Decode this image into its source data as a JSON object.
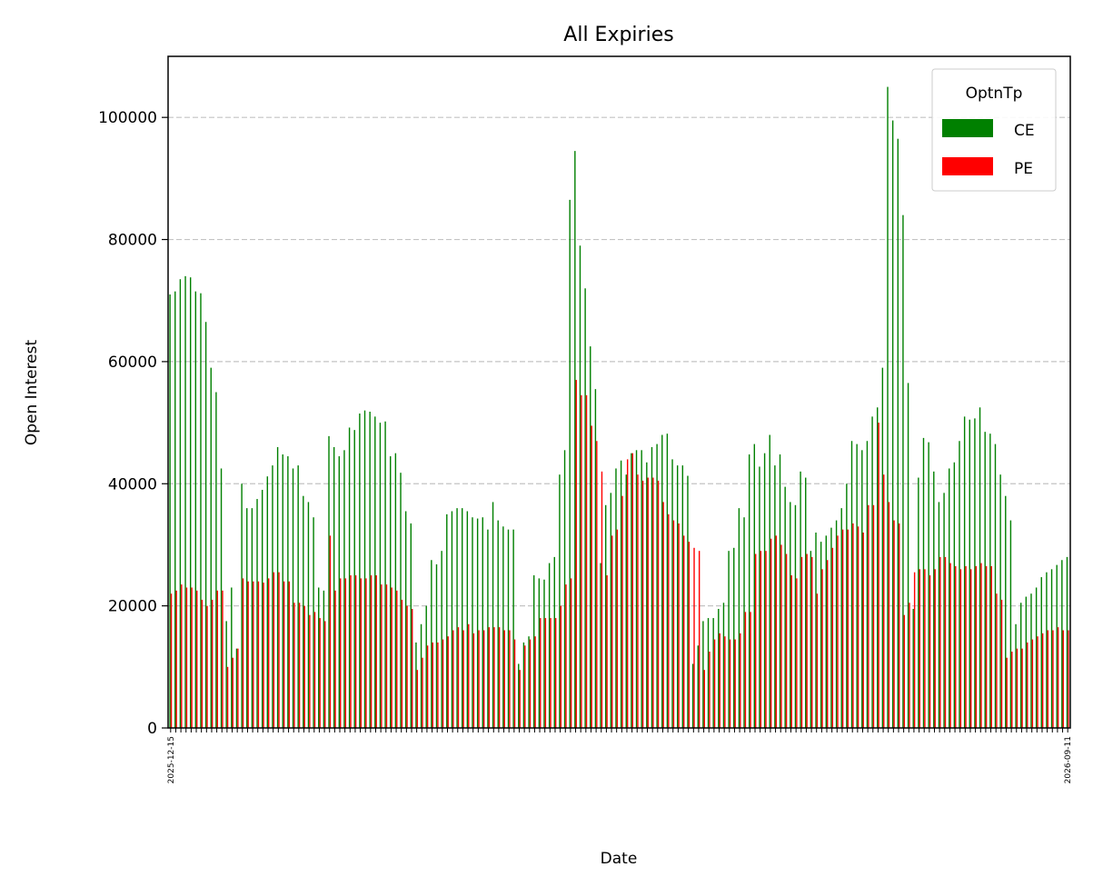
{
  "chart_data": {
    "type": "bar",
    "title": "All Expiries",
    "xlabel": "Date",
    "ylabel": "Open Interest",
    "ylim": [
      0,
      110000
    ],
    "yticks": [
      0,
      20000,
      40000,
      60000,
      80000,
      100000
    ],
    "grid": "y-dashed",
    "legend": {
      "title": "OptnTp",
      "placement": "top-right"
    },
    "colors": {
      "CE": "#008000",
      "PE": "#ff0000"
    },
    "first_category": "2025-12-15",
    "last_category": "2026-09-11",
    "series": [
      {
        "name": "CE",
        "values": [
          71000,
          71500,
          73500,
          74000,
          73800,
          71500,
          71200,
          66500,
          59000,
          55000,
          42500,
          17500,
          23000,
          13000,
          40000,
          36000,
          36000,
          37500,
          39000,
          41200,
          43000,
          46000,
          44800,
          44500,
          42500,
          43000,
          38000,
          37000,
          34500,
          23000,
          22500,
          47800,
          46000,
          44500,
          45500,
          49200,
          48800,
          51500,
          52000,
          51800,
          51000,
          50000,
          50200,
          44500,
          45000,
          41800,
          35500,
          33500,
          14000,
          17000,
          20000,
          27500,
          26800,
          29000,
          35000,
          35500,
          36000,
          36000,
          35500,
          34500,
          34300,
          34500,
          32500,
          37000,
          34000,
          33000,
          32500,
          32500,
          10500,
          14000,
          15000,
          25000,
          24500,
          24300,
          27000,
          28000,
          41500,
          45500,
          86500,
          94500,
          79000,
          72000,
          62500,
          55500,
          27000,
          36500,
          38500,
          42500,
          43800,
          41500,
          45000,
          45500,
          45500,
          43500,
          46000,
          46500,
          48000,
          48200,
          44000,
          43000,
          43000,
          41300,
          10500,
          13500,
          17500,
          18000,
          18000,
          19500,
          20500,
          29000,
          29500,
          36000,
          34500,
          44800,
          46500,
          42800,
          45000,
          48000,
          43000,
          44800,
          39500,
          37000,
          36500,
          42000,
          41000,
          29000,
          32000,
          30500,
          31500,
          32800,
          34000,
          36000,
          40000,
          47000,
          46500,
          45500,
          47000,
          51000,
          52500,
          59000,
          105000,
          99500,
          96500,
          84000,
          56500,
          19500,
          41000,
          47500,
          46800,
          42000,
          37000,
          38500,
          42500,
          43500,
          47000,
          51000,
          50500,
          50700,
          52500,
          48500,
          48200,
          46500,
          41500,
          38000,
          34000,
          17000,
          20500,
          21500,
          22000,
          23000,
          24700,
          25500,
          26000,
          26700,
          27500,
          28000
        ]
      },
      {
        "name": "PE",
        "values": [
          22000,
          22500,
          23500,
          23000,
          23000,
          22500,
          21000,
          20000,
          21000,
          22500,
          22500,
          10000,
          11500,
          13000,
          24500,
          24000,
          24000,
          24000,
          23800,
          24500,
          25500,
          25500,
          24000,
          24000,
          20500,
          20500,
          20000,
          18500,
          19000,
          18000,
          17500,
          31500,
          22500,
          24500,
          24500,
          25000,
          25000,
          24500,
          24500,
          25000,
          25000,
          23500,
          23500,
          23000,
          22500,
          21000,
          20000,
          19500,
          9500,
          11500,
          13500,
          14000,
          14000,
          14500,
          15000,
          16000,
          16500,
          16000,
          17000,
          15500,
          16000,
          16000,
          16500,
          16500,
          16500,
          16000,
          16000,
          14500,
          9500,
          13500,
          14500,
          15000,
          18000,
          18000,
          18000,
          18000,
          20000,
          23500,
          24500,
          57000,
          54500,
          54500,
          49500,
          47000,
          42000,
          25000,
          31500,
          32500,
          38000,
          44000,
          45000,
          41500,
          40500,
          41000,
          41000,
          40500,
          37000,
          35000,
          34000,
          33500,
          31500,
          30500,
          29500,
          29000,
          9500,
          12500,
          14500,
          15500,
          15000,
          14500,
          14500,
          15500,
          19000,
          19000,
          28500,
          29000,
          29000,
          31000,
          31500,
          30000,
          28500,
          25000,
          24500,
          28000,
          28500,
          28000,
          22000,
          26000,
          27500,
          29500,
          31500,
          32500,
          32500,
          33500,
          33000,
          32000,
          36500,
          36500,
          50000,
          41500,
          37000,
          34000,
          33500,
          18500,
          20500,
          25500,
          26000,
          26000,
          25000,
          26000,
          28000,
          28000,
          27000,
          26500,
          26000,
          26500,
          26000,
          26500,
          27000,
          26500,
          26500,
          22000,
          21000,
          11500,
          12500,
          13000,
          13000,
          14000,
          14500,
          15000,
          15500,
          16000,
          16000,
          16500,
          16000,
          16000
        ]
      }
    ]
  }
}
